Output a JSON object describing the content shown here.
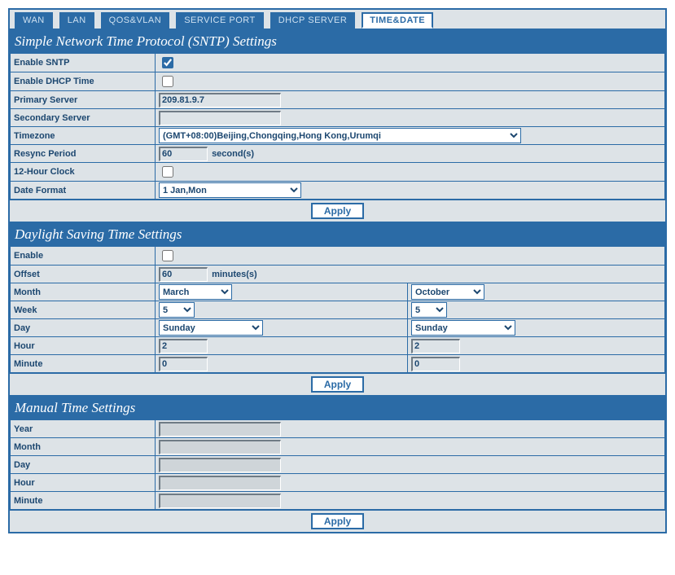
{
  "tabs": [
    {
      "label": "WAN",
      "active": false
    },
    {
      "label": "LAN",
      "active": false
    },
    {
      "label": "QOS&VLAN",
      "active": false
    },
    {
      "label": "SERVICE PORT",
      "active": false
    },
    {
      "label": "DHCP SERVER",
      "active": false
    },
    {
      "label": "TIME&DATE",
      "active": true
    }
  ],
  "sntp": {
    "header": "Simple Network Time Protocol (SNTP) Settings",
    "enable_sntp_label": "Enable SNTP",
    "enable_sntp": true,
    "enable_dhcp_time_label": "Enable DHCP Time",
    "enable_dhcp_time": false,
    "primary_server_label": "Primary Server",
    "primary_server": "209.81.9.7",
    "secondary_server_label": "Secondary Server",
    "secondary_server": "",
    "timezone_label": "Timezone",
    "timezone": "(GMT+08:00)Beijing,Chongqing,Hong Kong,Urumqi",
    "resync_label": "Resync Period",
    "resync_value": "60",
    "resync_suffix": "second(s)",
    "hour12_label": "12-Hour Clock",
    "hour12": false,
    "date_format_label": "Date Format",
    "date_format": "1 Jan,Mon",
    "apply": "Apply"
  },
  "dst": {
    "header": "Daylight Saving Time Settings",
    "enable_label": "Enable",
    "enable": false,
    "offset_label": "Offset",
    "offset_value": "60",
    "offset_suffix": "minutes(s)",
    "month_label": "Month",
    "month_start": "March",
    "month_end": "October",
    "week_label": "Week",
    "week_start": "5",
    "week_end": "5",
    "day_label": "Day",
    "day_start": "Sunday",
    "day_end": "Sunday",
    "hour_label": "Hour",
    "hour_start": "2",
    "hour_end": "2",
    "minute_label": "Minute",
    "minute_start": "0",
    "minute_end": "0",
    "apply": "Apply"
  },
  "manual": {
    "header": "Manual Time Settings",
    "year_label": "Year",
    "year": "",
    "month_label": "Month",
    "month": "",
    "day_label": "Day",
    "day": "",
    "hour_label": "Hour",
    "hour": "",
    "minute_label": "Minute",
    "minute": "",
    "apply": "Apply"
  }
}
